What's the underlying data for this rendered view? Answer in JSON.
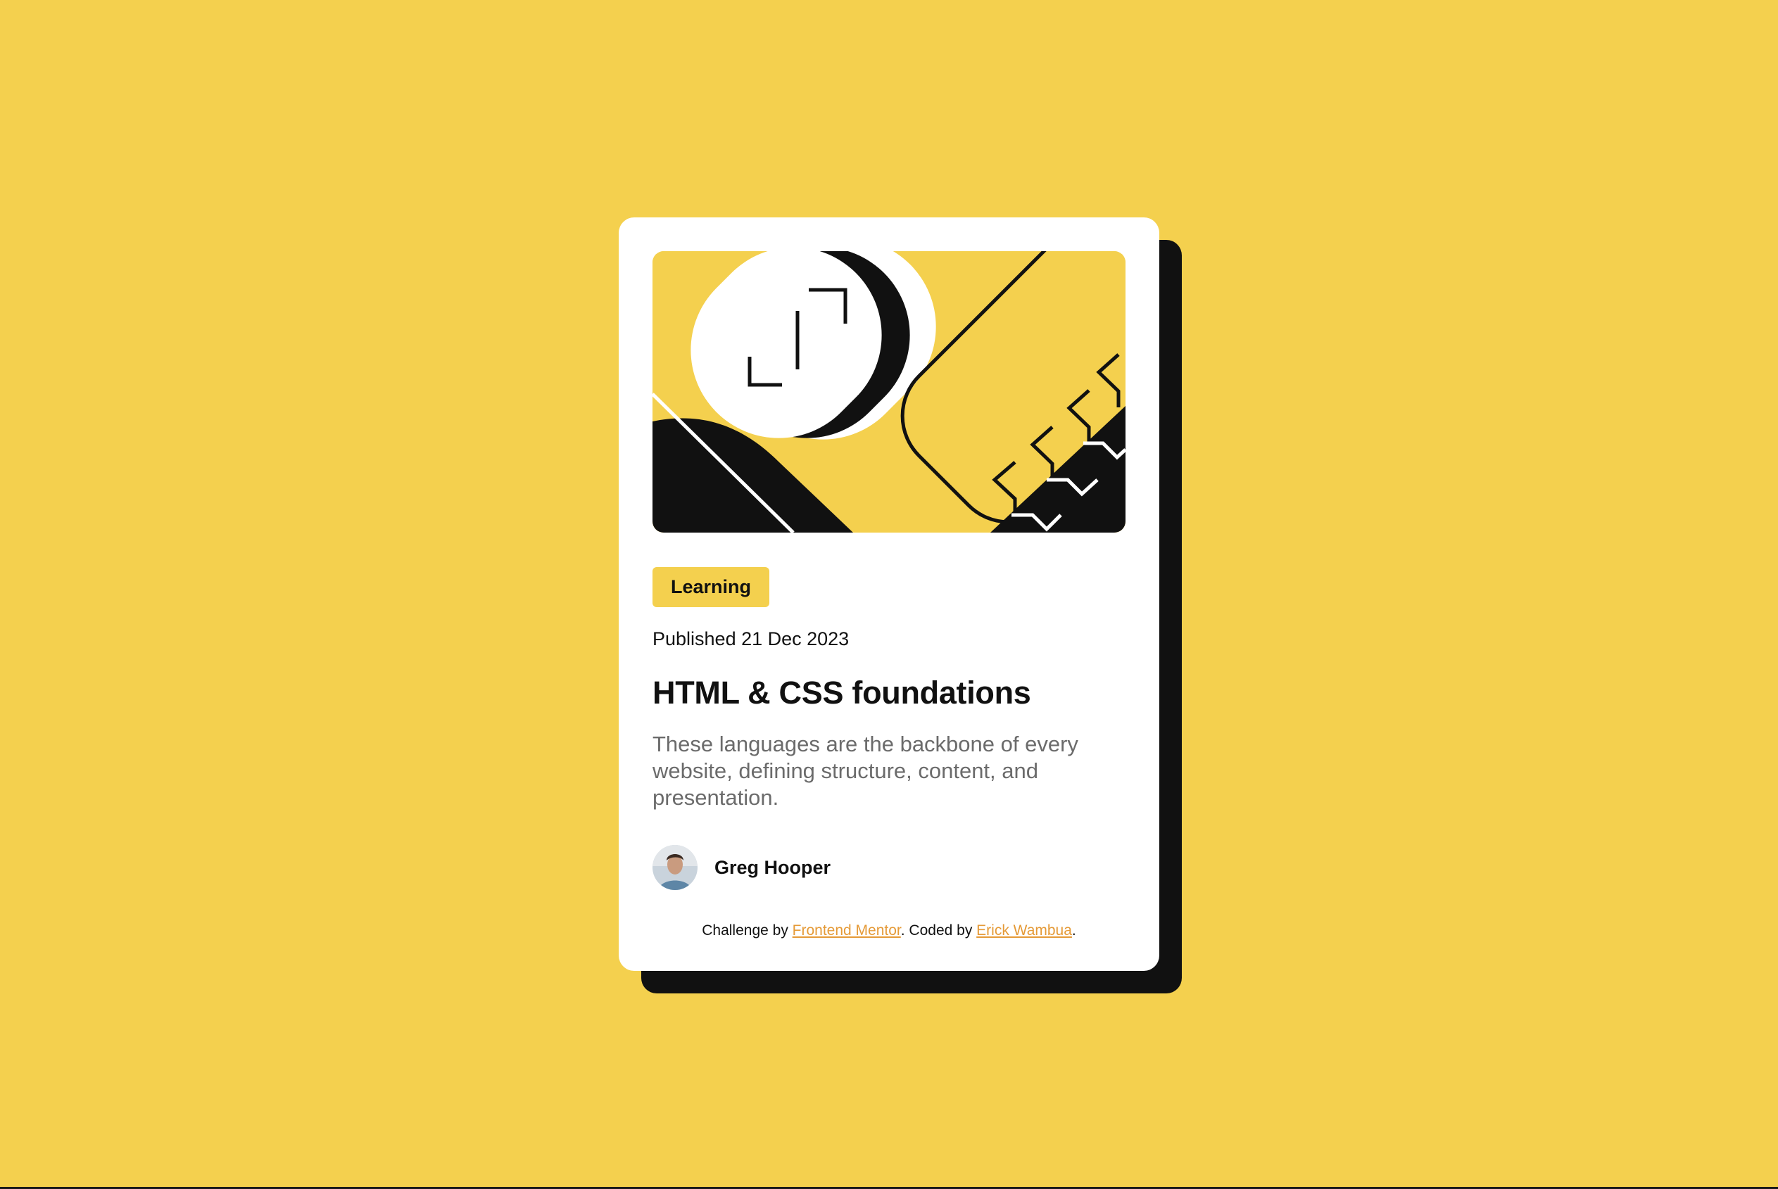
{
  "card": {
    "tag": "Learning",
    "published": "Published 21 Dec 2023",
    "title": "HTML & CSS foundations",
    "description": "These languages are the backbone of every website, defining structure, content, and presentation.",
    "author": "Greg Hooper"
  },
  "attribution": {
    "prefix": "Challenge by ",
    "link1": "Frontend Mentor",
    "middle": ". Coded by ",
    "link2": "Erick Wambua",
    "suffix": "."
  },
  "colors": {
    "background": "#F4D04E",
    "card": "#FFFFFF",
    "shadow": "#111111",
    "text": "#111111",
    "muted": "#6B6B6B",
    "link": "#E59A37"
  },
  "icons": {
    "hero": "abstract-illustration",
    "avatar": "author-avatar"
  }
}
